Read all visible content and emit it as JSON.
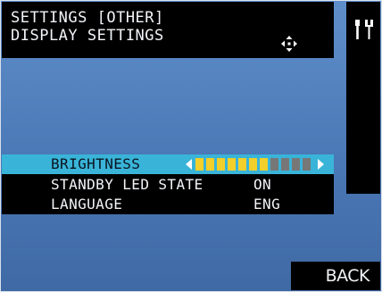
{
  "header": {
    "line1": "SETTINGS [OTHER]",
    "line2": "DISPLAY SETTINGS",
    "move_icon": "four-way-arrow-icon"
  },
  "side_panel": {
    "icon": "tools-icon"
  },
  "menu": {
    "items": [
      {
        "label": "BRIGHTNESS",
        "value": ""
      },
      {
        "label": "STANDBY LED STATE",
        "value": "ON"
      },
      {
        "label": "LANGUAGE",
        "value": "ENG"
      }
    ],
    "brightness": {
      "level": 7,
      "max": 11
    }
  },
  "footer": {
    "back_label": "BACK"
  },
  "colors": {
    "background": "#4a78b6",
    "panel": "#000000",
    "selection": "#39b4d8",
    "slider_on": "#f2cf2b",
    "slider_off": "#777777"
  }
}
